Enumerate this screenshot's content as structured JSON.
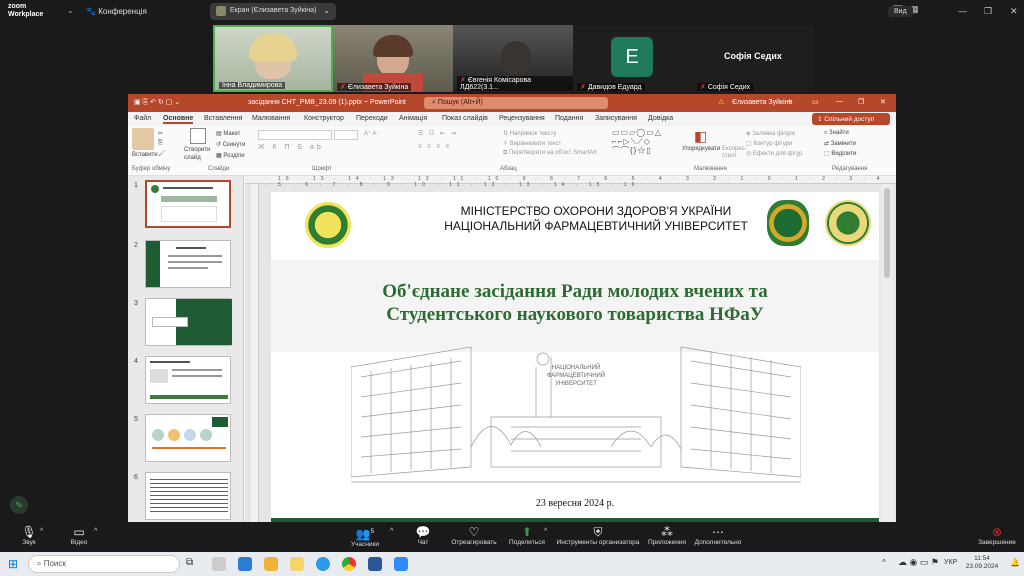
{
  "zoom": {
    "logo_line1": "zoom",
    "logo_line2": "Workplace",
    "conference_label": "Конференція",
    "screen_share_label": "Екран (Єлизавета Зуйкіна)",
    "view_label": "Вид"
  },
  "participants": [
    {
      "name": "Інна Владимирова"
    },
    {
      "name": "Єлизавета Зуйкіна"
    },
    {
      "name": "Євгенія Комісарова ЛД622(3.1..."
    },
    {
      "name": "Давидов Едуард",
      "initial": "E",
      "tile_color": "#1e7a5a"
    },
    {
      "name": "Софія Седих",
      "heading": "Софія Седих"
    }
  ],
  "powerpoint": {
    "file_name": "засідання СНТ_РМВ_23.09 (1).pptx  ~  PowerPoint",
    "search_placeholder": "Пошук (Alt+Й)",
    "user": "Єлизавета Зуйкіна",
    "share_label": "Спільний доступ",
    "tabs": [
      "Файл",
      "Основне",
      "Вставлення",
      "Малювання",
      "Конструктор",
      "Переходи",
      "Анімація",
      "Показ слайдів",
      "Рецензування",
      "Подання",
      "Записування",
      "Довідка"
    ],
    "active_tab": "Основне",
    "ribbon": {
      "paste": "Вставити",
      "clipboard": "Буфер обміну",
      "new_slide": "Створити слайд",
      "layout": "Макет",
      "reset": "Скинути",
      "sections": "Розділи",
      "slides_group": "Слайди",
      "font_group": "Шрифт",
      "para_group": "Абзац",
      "text_direction": "Напрямок тексту",
      "align_text": "Вирівнювати текст",
      "smartart": "Перетворити на об'єкт SmartArt",
      "arrange": "Упорядкувати",
      "quick_styles": "Експрес-стилі",
      "drawing_group": "Малювання",
      "shape_fill": "Заливка фігури",
      "shape_outline": "Контур фігури",
      "shape_effects": "Ефекти для фігур",
      "find": "Знайти",
      "replace": "Замінити",
      "select": "Виділити",
      "editing_group": "Редагування"
    },
    "thumbnail_numbers": [
      "1",
      "2",
      "3",
      "4",
      "5",
      "6"
    ],
    "slide": {
      "header_line1": "МІНІСТЕРСТВО ОХОРОНИ ЗДОРОВ'Я УКРАЇНИ",
      "header_line2": "НАЦІОНАЛЬНИЙ ФАРМАЦЕВТИЧНИЙ УНІВЕРСИТЕТ",
      "title_line1": "Об'єднане засідання Ради молодих вчених та",
      "title_line2": "Студентського наукового товариства НФаУ",
      "building_sign_line1": "НАЦІОНАЛЬНИЙ",
      "building_sign_line2": "ФАРМАЦЕВТИЧНИЙ",
      "building_sign_line3": "УНІВЕРСИТЕТ",
      "date": "23 вересня 2024 р."
    },
    "colors": {
      "titlebar": "#b7472a",
      "slide_green": "#1f5c33",
      "title_green": "#2e6b32"
    }
  },
  "zoom_controls": [
    {
      "label": "Звук",
      "icon": "microphone-icon"
    },
    {
      "label": "Відео",
      "icon": "camera-icon"
    },
    {
      "label": "Учасники",
      "icon": "participants-icon",
      "count": "5"
    },
    {
      "label": "Чат",
      "icon": "chat-icon"
    },
    {
      "label": "Отреагировать",
      "icon": "heart-icon"
    },
    {
      "label": "Поделиться",
      "icon": "share-icon"
    },
    {
      "label": "Инструменты организатора",
      "icon": "shield-icon"
    },
    {
      "label": "Приложения",
      "icon": "apps-icon"
    },
    {
      "label": "Дополнительно",
      "icon": "more-icon"
    },
    {
      "label": "Завершение",
      "icon": "end-icon"
    }
  ],
  "taskbar": {
    "search_placeholder": "Поиск",
    "language": "УКР",
    "time": "11:54",
    "date": "23.09.2024"
  }
}
